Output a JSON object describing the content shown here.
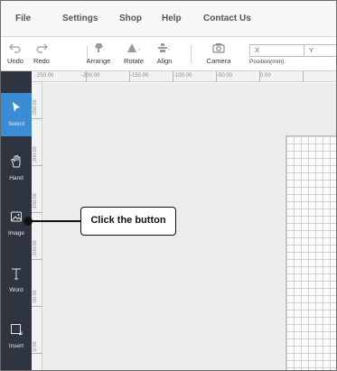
{
  "menubar": {
    "items": [
      {
        "label": "File"
      },
      {
        "label": "Settings"
      },
      {
        "label": "Shop"
      },
      {
        "label": "Help"
      },
      {
        "label": "Contact Us"
      }
    ]
  },
  "toolbar": {
    "tools": [
      {
        "label": "Undo",
        "icon": "undo-icon"
      },
      {
        "label": "Redo",
        "icon": "redo-icon"
      },
      {
        "label": "Arrange",
        "icon": "arrange-icon"
      },
      {
        "label": "Rotate",
        "icon": "rotate-icon"
      },
      {
        "label": "Align",
        "icon": "align-icon"
      },
      {
        "label": "Camera",
        "icon": "camera-icon"
      }
    ],
    "x_field": {
      "value": "X"
    },
    "y_field": {
      "value": "Y"
    },
    "position_label": "Position(mm)"
  },
  "sidebar": {
    "items": [
      {
        "label": "Select",
        "icon": "cursor-arrow-icon",
        "active": true
      },
      {
        "label": "Hand",
        "icon": "hand-icon",
        "active": false
      },
      {
        "label": "Image",
        "icon": "image-icon",
        "active": false
      },
      {
        "label": "Word",
        "icon": "text-icon",
        "active": false
      },
      {
        "label": "Insert",
        "icon": "insert-shape-icon",
        "active": false
      }
    ]
  },
  "ruler": {
    "horizontal_labels": [
      "-250.00",
      "-200.00",
      "-150.00",
      "-100.00",
      "-50.00",
      "0.00"
    ],
    "vertical_labels": [
      "-250.00",
      "-200.00",
      "-150.00",
      "-100.00",
      "-50.00",
      "0.00"
    ]
  },
  "callout": {
    "text": "Click the button"
  },
  "colors": {
    "sidebar_bg": "#2e3440",
    "active_accent": "#3b8cd6",
    "canvas_bg": "#ececec"
  }
}
